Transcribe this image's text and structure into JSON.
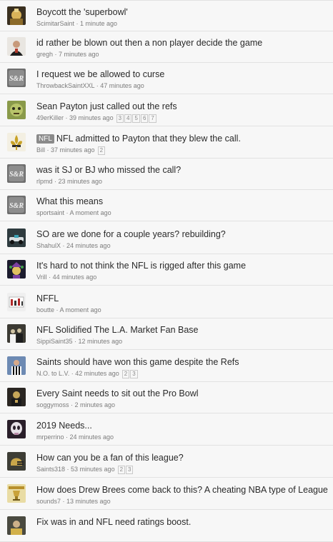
{
  "threads": [
    {
      "title": "Boycott the 'superbowl'",
      "author": "ScimitarSaint",
      "time": "1 minute ago",
      "pages": [],
      "avatar": "saint-face-avatar",
      "prefix": ""
    },
    {
      "title": "id rather be blown out then a non player decide the game",
      "author": "gregh",
      "time": "7 minutes ago",
      "pages": [],
      "avatar": "man-portrait-avatar",
      "prefix": ""
    },
    {
      "title": "I request we be allowed to curse",
      "author": "ThrowbackSaintXXL",
      "time": "47 minutes ago",
      "pages": [],
      "avatar": "site-logo-avatar",
      "prefix": ""
    },
    {
      "title": "Sean Payton just called out the refs",
      "author": "49erKiller",
      "time": "39 minutes ago",
      "pages": [
        "3",
        "4",
        "5",
        "6",
        "7"
      ],
      "avatar": "green-face-avatar",
      "prefix": ""
    },
    {
      "title": "NFL admitted to Payton that they blew the call.",
      "author": "Bill",
      "time": "37 minutes ago",
      "pages": [
        "2"
      ],
      "avatar": "fleur-de-lis-avatar",
      "prefix": "NFL"
    },
    {
      "title": "was it SJ or BJ who missed the call?",
      "author": "rlpmd",
      "time": "23 minutes ago",
      "pages": [],
      "avatar": "site-logo-avatar",
      "prefix": ""
    },
    {
      "title": "What this means",
      "author": "sportsaint",
      "time": "A moment ago",
      "pages": [],
      "avatar": "site-logo-avatar",
      "prefix": ""
    },
    {
      "title": "SO are we done for a couple years? rebuilding?",
      "author": "ShahulX",
      "time": "24 minutes ago",
      "pages": [],
      "avatar": "race-car-avatar",
      "prefix": ""
    },
    {
      "title": "It's hard to not think the NFL is rigged after this game",
      "author": "Vrill",
      "time": "44 minutes ago",
      "pages": [],
      "avatar": "jester-avatar",
      "prefix": ""
    },
    {
      "title": "NFFL",
      "author": "boutte",
      "time": "A moment ago",
      "pages": [],
      "avatar": "bar-graphic-avatar",
      "prefix": ""
    },
    {
      "title": "NFL Solidified The L.A. Market Fan Base",
      "author": "SippiSaint35",
      "time": "12 minutes ago",
      "pages": [],
      "avatar": "team-photo-avatar",
      "prefix": ""
    },
    {
      "title": "Saints should have won this game despite the Refs",
      "author": "N.O. to L.V.",
      "time": "42 minutes ago",
      "pages": [
        "2",
        "3"
      ],
      "avatar": "referee-avatar",
      "prefix": ""
    },
    {
      "title": "Every Saint needs to sit out the Pro Bowl",
      "author": "soggymoss",
      "time": "2 minutes ago",
      "pages": [],
      "avatar": "player-avatar",
      "prefix": ""
    },
    {
      "title": "2019 Needs...",
      "author": "mrperrino",
      "time": "24 minutes ago",
      "pages": [],
      "avatar": "skull-avatar",
      "prefix": ""
    },
    {
      "title": "How can you be a fan of this league?",
      "author": "Saints318",
      "time": "53 minutes ago",
      "pages": [
        "2",
        "3"
      ],
      "avatar": "helmet-avatar",
      "prefix": ""
    },
    {
      "title": "How does Drew Brees come back to this? A cheating NBA type of League",
      "author": "sounds7",
      "time": "13 minutes ago",
      "pages": [],
      "avatar": "trophy-avatar",
      "prefix": ""
    },
    {
      "title": "Fix was in and NFL need ratings boost.",
      "author": "",
      "time": "",
      "pages": [],
      "avatar": "fan-photo-avatar",
      "prefix": ""
    }
  ]
}
